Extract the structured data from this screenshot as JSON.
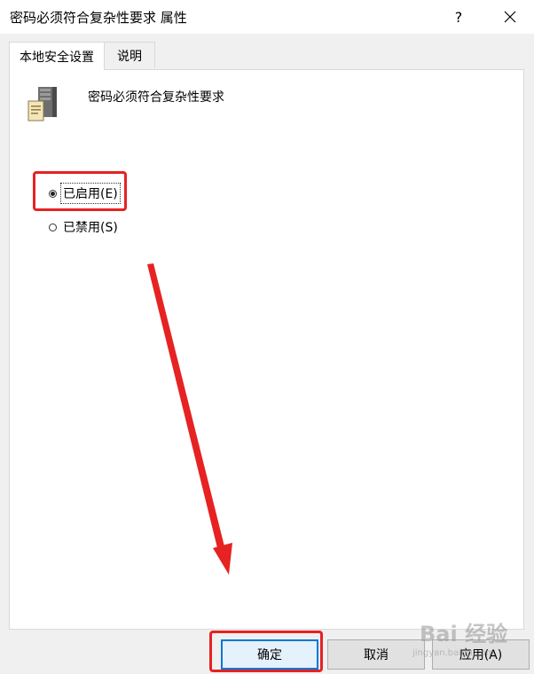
{
  "window": {
    "title": "密码必须符合复杂性要求 属性",
    "help_glyph": "?",
    "close_icon": "close-icon"
  },
  "tabs": [
    {
      "label": "本地安全设置",
      "active": true
    },
    {
      "label": "说明",
      "active": false
    }
  ],
  "policy": {
    "icon": "server-policy-icon",
    "name": "密码必须符合复杂性要求"
  },
  "options": {
    "enabled": {
      "label": "已启用(E)",
      "checked": true
    },
    "disabled": {
      "label": "已禁用(S)",
      "checked": false
    }
  },
  "buttons": {
    "ok": "确定",
    "cancel": "取消",
    "apply": "应用(A)"
  },
  "annotation": {
    "color": "#e62222"
  },
  "watermark": {
    "brand": "Bai 经验",
    "url": "jingyan.baidu.com"
  }
}
